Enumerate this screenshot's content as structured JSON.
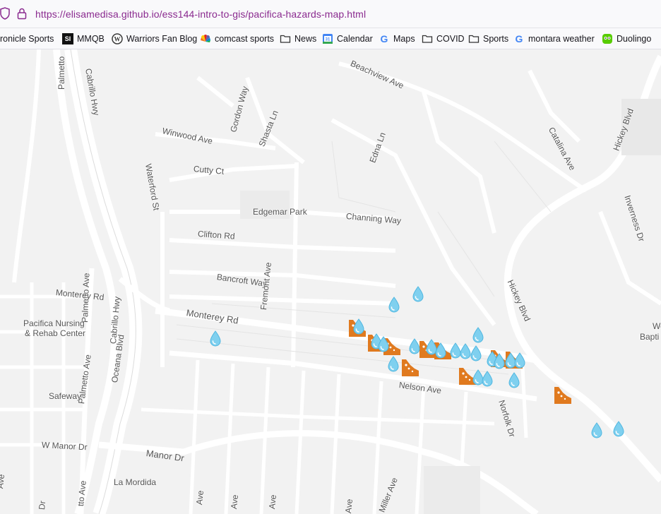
{
  "browser": {
    "url": "https://elisamedisa.github.io/ess144-intro-to-gis/pacifica-hazards-map.html"
  },
  "bookmarks": [
    {
      "label": "ronicle Sports",
      "icon": "folder-icon"
    },
    {
      "label": "MMQB",
      "icon": "si-icon"
    },
    {
      "label": "Warriors Fan Blog",
      "icon": "wordpress-icon"
    },
    {
      "label": "comcast sports",
      "icon": "nbc-icon"
    },
    {
      "label": "News",
      "icon": "folder-icon"
    },
    {
      "label": "Calendar",
      "icon": "calendar-icon"
    },
    {
      "label": "Maps",
      "icon": "google-icon"
    },
    {
      "label": "COVID",
      "icon": "folder-icon"
    },
    {
      "label": "Sports",
      "icon": "folder-icon"
    },
    {
      "label": "montara weather",
      "icon": "google-icon"
    },
    {
      "label": "Duolingo",
      "icon": "duolingo-icon"
    }
  ],
  "map": {
    "streets": {
      "palmetto_top": "Palmetto",
      "cabrillo_top": "Cabrillo Hwy",
      "beachview": "Beachview Ave",
      "gordon": "Gordon Way",
      "shasta": "Shasta Ln",
      "winwood": "Winwood Ave",
      "edna": "Edna Ln",
      "catalina": "Catalina Ave",
      "hickey_top": "Hickey Blvd",
      "cutty": "Cutty Ct",
      "waterford": "Waterford St",
      "inverness": "Inverness Dr",
      "edgemar": "Edgemar Park",
      "channing": "Channing Way",
      "clifton": "Clifton Rd",
      "palmetto_mid": "Palmetto Ave",
      "bancroft": "Bancroft Way",
      "fremont": "Fremont Ave",
      "monterey_left": "Monterey Rd",
      "cabrillo_mid": "Cabrillo Hwy",
      "hickey_mid": "Hickey Blvd",
      "monterey_main": "Monterey Rd",
      "pacifica_nursing_1": "Pacifica Nursing",
      "pacifica_nursing_2": "& Rehab Center",
      "we": "We",
      "bapti": "Bapti",
      "oceana": "Oceana Blvd",
      "safeway": "Safeway",
      "nelson": "Nelson Ave",
      "norfolk": "Norfolk Dr",
      "palmetto_low": "Palmetto Ave",
      "w_manor": "W Manor Dr",
      "manor": "Manor Dr",
      "la_mordida": "La Mordida",
      "ave_1": "Ave",
      "dr_1": "Dr",
      "to_ave": "tto Ave",
      "ave_2": "Ave",
      "ave_3": "Ave",
      "ave_4": "Ave",
      "miller": "Miller Ave",
      "ave_5": "Ave"
    },
    "markers": {
      "water": "water-drop-icon",
      "landslide": "landslide-icon"
    }
  }
}
